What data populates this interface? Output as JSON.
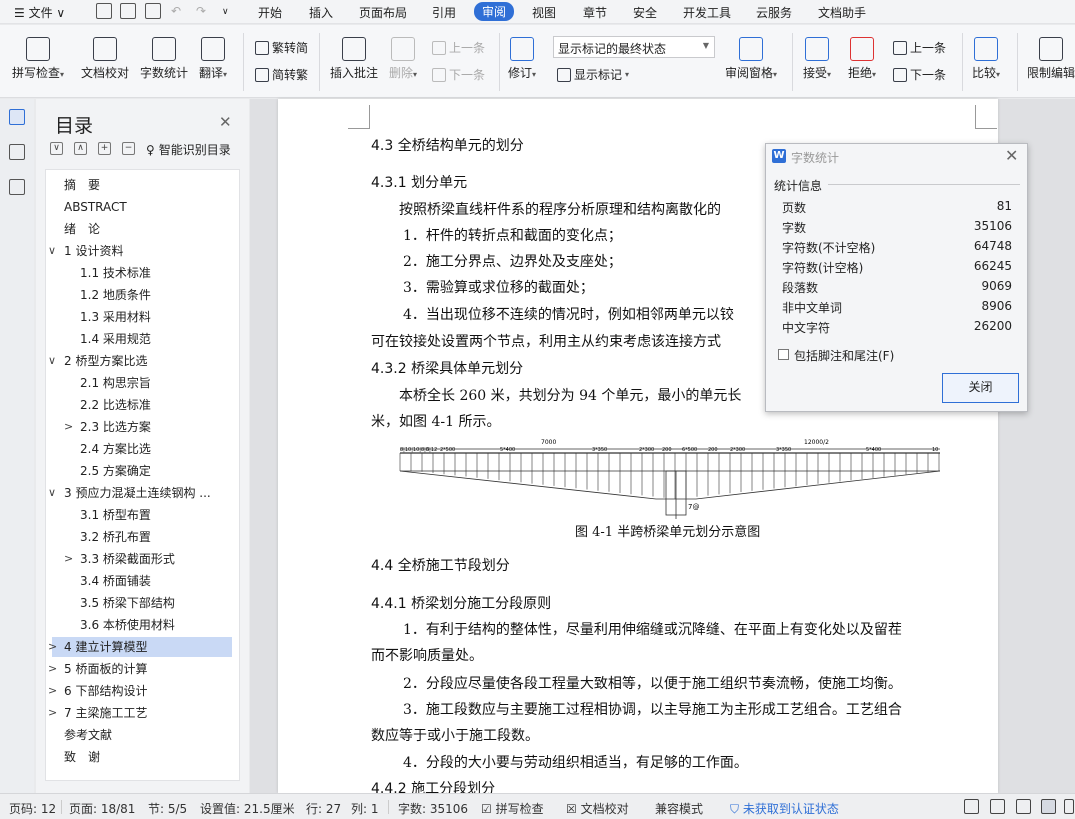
{
  "menubar": {
    "hamburger": "文件",
    "tabs": [
      "开始",
      "插入",
      "页面布局",
      "引用",
      "审阅",
      "视图",
      "章节",
      "安全",
      "开发工具",
      "云服务",
      "文档助手"
    ],
    "active_tab": "审阅"
  },
  "ribbon": {
    "spell_check": "拼写检查",
    "doc_proof": "文档校对",
    "word_count": "字数统计",
    "translate": "翻译",
    "trad_to_simp": "繁转简",
    "simp_to_trad": "简转繁",
    "insert_comment": "插入批注",
    "delete": "删除",
    "prev_comment": "上一条",
    "next_comment": "下一条",
    "revise": "修订",
    "show_mode": "显示标记的最终状态",
    "show_marks": "显示标记",
    "review_pane": "审阅窗格",
    "accept": "接受",
    "reject": "拒绝",
    "prev": "上一条",
    "next": "下一条",
    "compare": "比较",
    "restrict_edit": "限制编辑"
  },
  "outline": {
    "title": "目录",
    "smart": "智能识别目录",
    "items": [
      {
        "label": "摘　要",
        "level": 0,
        "toggle": ""
      },
      {
        "label": "ABSTRACT",
        "level": 0,
        "toggle": ""
      },
      {
        "label": "绪　论",
        "level": 0,
        "toggle": ""
      },
      {
        "label": "1  设计资料",
        "level": 0,
        "toggle": "∨"
      },
      {
        "label": "1.1  技术标准",
        "level": 1,
        "toggle": ""
      },
      {
        "label": "1.2  地质条件",
        "level": 1,
        "toggle": ""
      },
      {
        "label": "1.3  采用材料",
        "level": 1,
        "toggle": ""
      },
      {
        "label": "1.4  采用规范",
        "level": 1,
        "toggle": ""
      },
      {
        "label": "2  桥型方案比选",
        "level": 0,
        "toggle": "∨"
      },
      {
        "label": "2.1  构思宗旨",
        "level": 1,
        "toggle": ""
      },
      {
        "label": "2.2  比选标准",
        "level": 1,
        "toggle": ""
      },
      {
        "label": "2.3  比选方案",
        "level": 1,
        "toggle": ">"
      },
      {
        "label": "2.4  方案比选",
        "level": 1,
        "toggle": ""
      },
      {
        "label": "2.5  方案确定",
        "level": 1,
        "toggle": ""
      },
      {
        "label": "3  预应力混凝土连续钢构 ...",
        "level": 0,
        "toggle": "∨"
      },
      {
        "label": "3.1  桥型布置",
        "level": 1,
        "toggle": ""
      },
      {
        "label": "3.2  桥孔布置",
        "level": 1,
        "toggle": ""
      },
      {
        "label": "3.3  桥梁截面形式",
        "level": 1,
        "toggle": ">"
      },
      {
        "label": "3.4  桥面铺装",
        "level": 1,
        "toggle": ""
      },
      {
        "label": "3.5  桥梁下部结构",
        "level": 1,
        "toggle": ""
      },
      {
        "label": "3.6  本桥使用材料",
        "level": 1,
        "toggle": ""
      },
      {
        "label": "4  建立计算模型",
        "level": 0,
        "toggle": ">",
        "selected": true
      },
      {
        "label": "5  桥面板的计算",
        "level": 0,
        "toggle": ">"
      },
      {
        "label": "6  下部结构设计",
        "level": 0,
        "toggle": ">"
      },
      {
        "label": "7  主梁施工工艺",
        "level": 0,
        "toggle": ">"
      },
      {
        "label": "参考文献",
        "level": 0,
        "toggle": ""
      },
      {
        "label": "致　谢",
        "level": 0,
        "toggle": ""
      }
    ]
  },
  "document": {
    "lines": [
      {
        "text": "4.3  全桥结构单元的划分",
        "heading": true
      },
      {
        "text": "4.3.1  划分单元",
        "heading": true
      },
      {
        "text": "按照桥梁直线杆件系的程序分析原理和结构离散化的"
      },
      {
        "text": "1．杆件的转折点和截面的变化点；"
      },
      {
        "text": "2．施工分界点、边界处及支座处；"
      },
      {
        "text": "3．需验算或求位移的截面处；"
      },
      {
        "text": "4．当出现位移不连续的情况时，例如相邻两单元以铰"
      },
      {
        "text": "可在铰接处设置两个节点，利用主从约束考虑该连接方式"
      },
      {
        "text": "4.3.2  桥梁具体单元划分",
        "heading": true
      },
      {
        "text": "本桥全长 260 米，共划分为 94 个单元，最小的单元长"
      },
      {
        "text": "米，如图 4-1 所示。"
      },
      {
        "text": "4.4  全桥施工节段划分",
        "heading": true
      },
      {
        "text": "4.4.1  桥梁划分施工分段原则",
        "heading": true
      },
      {
        "text": "1．有利于结构的整体性，尽量利用伸缩缝或沉降缝、在平面上有变化处以及留茬"
      },
      {
        "text": "而不影响质量处。"
      },
      {
        "text": "2．分段应尽量使各段工程量大致相等，以便于施工组织节奏流畅，使施工均衡。"
      },
      {
        "text": "3．施工段数应与主要施工过程相协调，以主导施工为主形成工艺组合。工艺组合"
      },
      {
        "text": "数应等于或小于施工段数。"
      },
      {
        "text": "4．分段的大小要与劳动组织相适当，有足够的工作面。"
      },
      {
        "text": "4.4.2  施工分段划分",
        "heading": true
      }
    ],
    "figure_caption": "图 4-1  半跨桥梁单元划分示意图",
    "figure_labels": {
      "top_left": "7000",
      "top_right": "12000/2",
      "segments": [
        "8|10|10|8|6",
        "3|12",
        "2*500",
        "5*400",
        "3*350",
        "2*300",
        "200",
        "6*500",
        "200",
        "2*300",
        "3*350",
        "5*400",
        "10"
      ],
      "pier": "7@"
    }
  },
  "dialog": {
    "title": "字数统计",
    "section": "统计信息",
    "stats": [
      {
        "label": "页数",
        "value": "81"
      },
      {
        "label": "字数",
        "value": "35106"
      },
      {
        "label": "字符数(不计空格)",
        "value": "64748"
      },
      {
        "label": "字符数(计空格)",
        "value": "66245"
      },
      {
        "label": "段落数",
        "value": "9069"
      },
      {
        "label": "非中文单词",
        "value": "8906"
      },
      {
        "label": "中文字符",
        "value": "26200"
      }
    ],
    "include_footnotes": "包括脚注和尾注(F)",
    "close_button": "关闭"
  },
  "status": {
    "page_no": "页码: 12",
    "pages": "页面: 18/81",
    "section": "节: 5/5",
    "setting": "设置值: 21.5厘米",
    "row": "行: 27",
    "col": "列: 1",
    "words": "字数: 35106",
    "spell": "拼写检查",
    "proof": "文档校对",
    "compat": "兼容模式",
    "cert": "未获取到认证状态"
  }
}
